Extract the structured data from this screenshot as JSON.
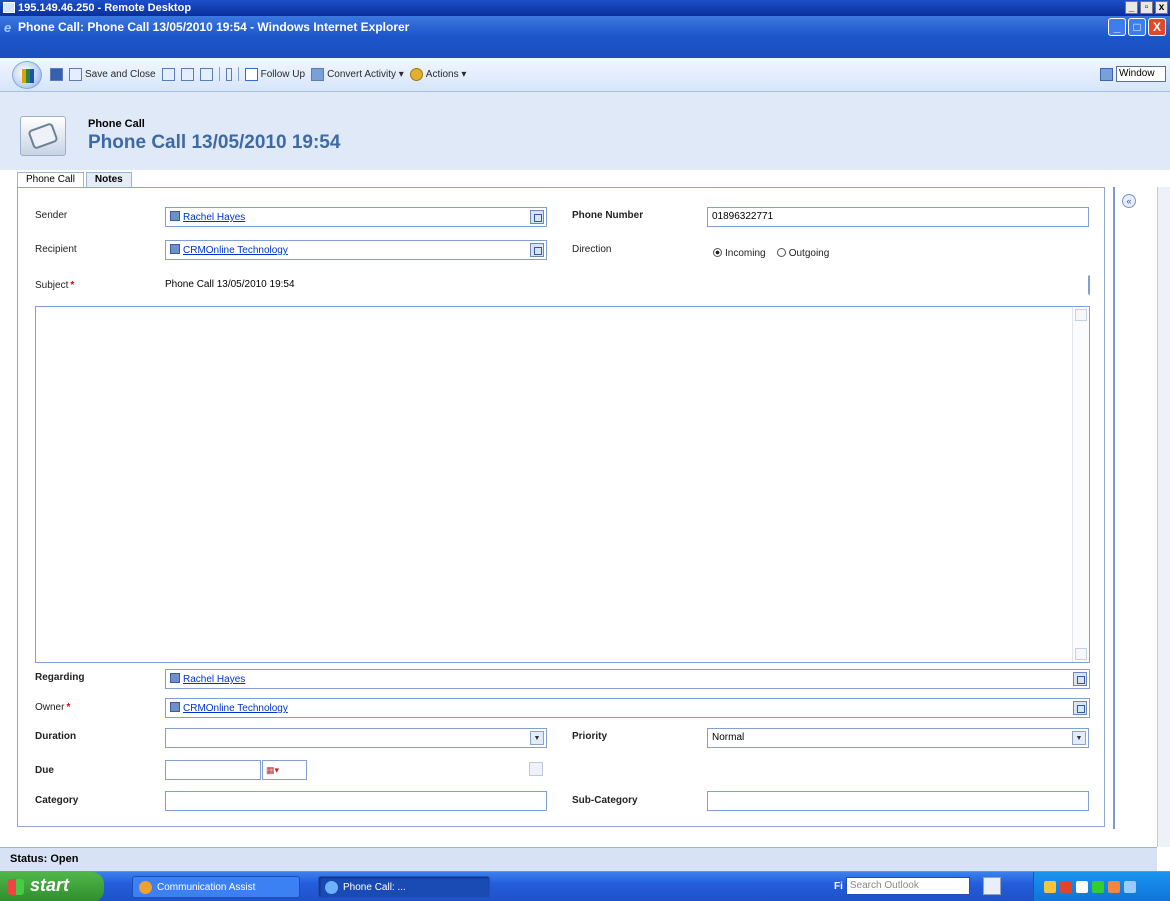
{
  "remote_desktop": {
    "title": "195.149.46.250 - Remote Desktop",
    "controls": [
      "_",
      "▫",
      "x"
    ]
  },
  "browser": {
    "title": "Phone Call: Phone Call 13/05/2010 19:54 - Windows Internet Explorer",
    "controls": [
      "_",
      "□",
      "X"
    ]
  },
  "toolbar": {
    "save_and_close": "Save and Close",
    "follow_up": "Follow Up",
    "convert_activity": "Convert Activity ▾",
    "actions": "Actions ▾",
    "search_box": "Window"
  },
  "header": {
    "entity_type": "Phone Call",
    "title": "Phone Call 13/05/2010 19:54"
  },
  "tabs": [
    {
      "label": "Phone Call"
    },
    {
      "label": "Notes"
    }
  ],
  "form": {
    "sender_label": "Sender",
    "sender_value": "Rachel Hayes",
    "recipient_label": "Recipient",
    "recipient_value": "CRMOnline Technology",
    "phone_number_label": "Phone Number",
    "phone_number_value": "01896322771",
    "direction_label": "Direction",
    "direction_incoming": "Incoming",
    "direction_outgoing": "Outgoing",
    "subject_label": "Subject",
    "subject_value": "Phone Call 13/05/2010 19:54",
    "regarding_label": "Regarding",
    "regarding_value": "Rachel Hayes",
    "owner_label": "Owner",
    "owner_value": "CRMOnline Technology",
    "duration_label": "Duration",
    "duration_value": "",
    "priority_label": "Priority",
    "priority_value": "Normal",
    "due_label": "Due",
    "due_value": "",
    "category_label": "Category",
    "category_value": "",
    "sub_category_label": "Sub-Category",
    "sub_category_value": ""
  },
  "status": {
    "text": "Status: Open"
  },
  "taskbar": {
    "start": "start",
    "task1": "Communication Assist",
    "task2": "Phone Call: ...",
    "search_label": "Fi",
    "search_placeholder": "Search Outlook"
  },
  "colors": {
    "title_bar": "#1d55c8",
    "header_title": "#3d6aa5",
    "form_header_bg": "#dfe9f7",
    "link": "#0033cc",
    "required": "#dd0000"
  }
}
